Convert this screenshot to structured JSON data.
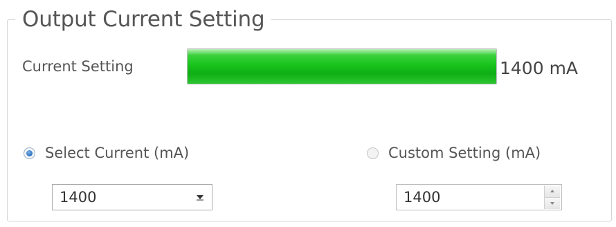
{
  "group": {
    "title": "Output Current Setting"
  },
  "current_setting": {
    "label": "Current Setting",
    "value_text": "1400 mA",
    "level_percent": 100,
    "bar_color": "#19c41c"
  },
  "select_current": {
    "label": "Select Current (mA)",
    "checked": true,
    "selected_value": "1400",
    "icon": "chevron-down-icon"
  },
  "custom_setting": {
    "label": "Custom Setting (mA)",
    "checked": false,
    "value": "1400",
    "icons": [
      "spin-up-icon",
      "spin-down-icon"
    ]
  }
}
